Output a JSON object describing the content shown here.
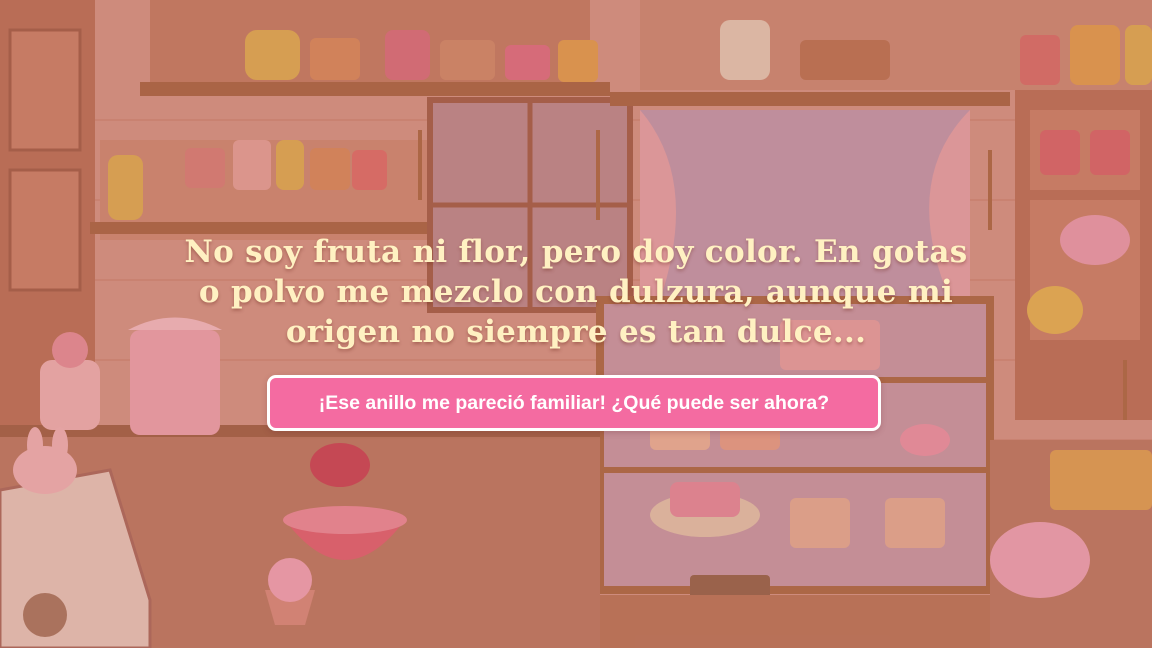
{
  "riddle": {
    "text": "No soy fruta ni flor, pero doy color. En gotas o polvo me mezclo con dulzura, aunque mi origen no siempre es tan dulce..."
  },
  "cta": {
    "label": "¡Ese anillo me pareció familiar! ¿Qué puede ser ahora?"
  },
  "colors": {
    "riddle_text": "#fff1c2",
    "button_bg": "#f46ba1",
    "button_border": "#ffffff",
    "scene_base": "#c98a7e"
  },
  "scene": {
    "description_icons": [
      "shelf-icon",
      "jar-icon",
      "cake-icon",
      "cupcake-icon",
      "teapot-icon",
      "window-icon",
      "display-case-icon",
      "bunny-icon",
      "mixing-bowl-icon"
    ]
  }
}
